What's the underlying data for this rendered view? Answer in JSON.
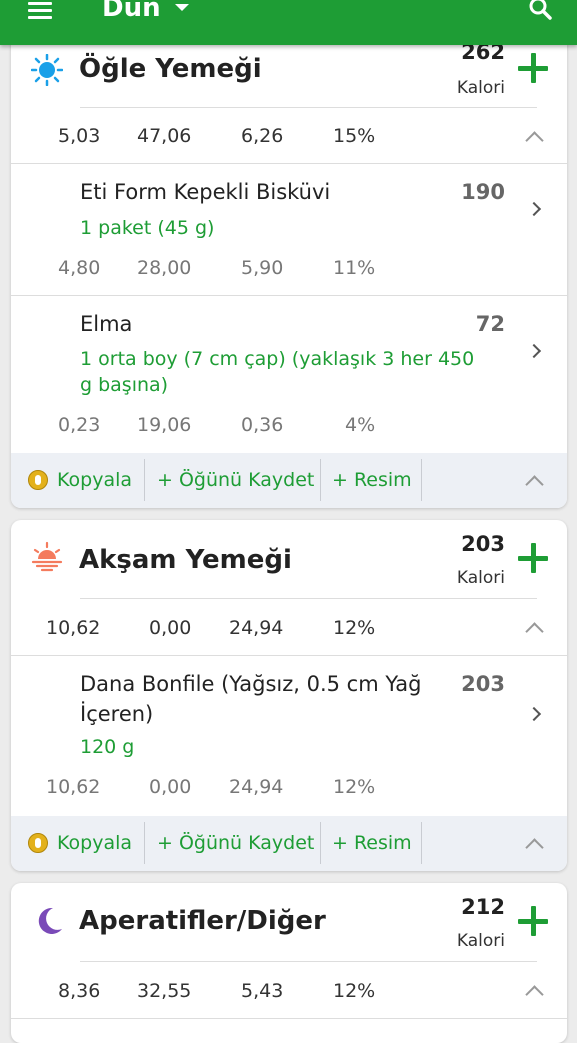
{
  "appbar": {
    "title": "Dün"
  },
  "meals": [
    {
      "key": "ogle",
      "title": "Öğle Yemeği",
      "calories": "262",
      "cal_label": "Kalori",
      "macros": [
        "5,03",
        "47,06",
        "6,26",
        "15%"
      ],
      "icon": "sun-icon",
      "foods": [
        {
          "name": "Eti Form Kepekli Bisküvi",
          "portion": "1 paket (45 g)",
          "calories": "190",
          "macros": [
            "4,80",
            "28,00",
            "5,90",
            "11%"
          ]
        },
        {
          "name": "Elma",
          "portion": "1 orta boy (7 cm çap) (yaklaşık 3 her 450 g başına)",
          "calories": "72",
          "macros": [
            "0,23",
            "19,06",
            "0,36",
            "4%"
          ]
        }
      ],
      "footer": {
        "copy": "Kopyala",
        "save": "+ Öğünü Kaydet",
        "image": "+ Resim"
      }
    },
    {
      "key": "aksam",
      "title": "Akşam Yemeği",
      "calories": "203",
      "cal_label": "Kalori",
      "macros": [
        "10,62",
        "0,00",
        "24,94",
        "12%"
      ],
      "icon": "sunset-icon",
      "foods": [
        {
          "name": "Dana Bonfile (Yağsız, 0.5 cm Yağ İçeren)",
          "portion": "120 g",
          "calories": "203",
          "macros": [
            "10,62",
            "0,00",
            "24,94",
            "12%"
          ]
        }
      ],
      "footer": {
        "copy": "Kopyala",
        "save": "+ Öğünü Kaydet",
        "image": "+ Resim"
      }
    },
    {
      "key": "aperatif",
      "title": "Aperatifler/Diğer",
      "calories": "212",
      "cal_label": "Kalori",
      "macros": [
        "8,36",
        "32,55",
        "5,43",
        "12%"
      ],
      "icon": "moon-icon"
    }
  ],
  "colors": {
    "brand": "#1e9d35",
    "card": "#ffffff",
    "background": "#ececec",
    "footer": "#edf0f5"
  }
}
